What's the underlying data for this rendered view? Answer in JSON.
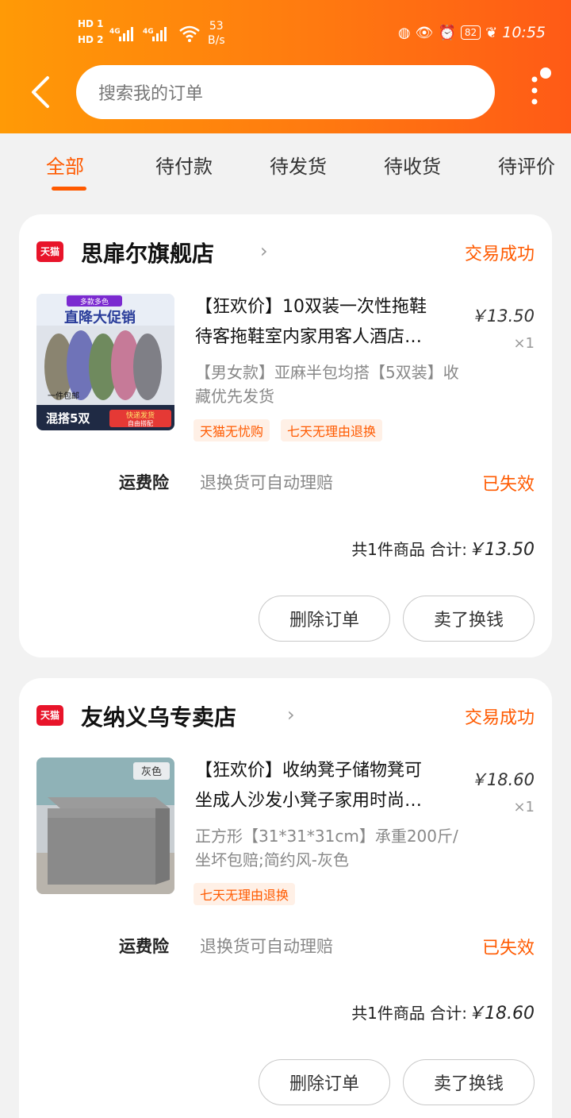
{
  "status_bar": {
    "hd1": "HD 1",
    "hd2": "HD 2",
    "speed_value": "53",
    "speed_unit": "B/s",
    "battery": "82",
    "time": "10:55"
  },
  "header": {
    "search_placeholder": "搜索我的订单"
  },
  "tabs": [
    {
      "label": "全部",
      "active": true
    },
    {
      "label": "待付款",
      "active": false
    },
    {
      "label": "待发货",
      "active": false
    },
    {
      "label": "待收货",
      "active": false
    },
    {
      "label": "待评价",
      "active": false
    }
  ],
  "orders": [
    {
      "platform_badge": "天猫",
      "shop_name": "思扉尔旗舰店",
      "status": "交易成功",
      "product_title_line1": "【狂欢价】10双装一次性拖鞋",
      "product_title_line2": "待客拖鞋室内家用客人酒店…",
      "product_spec": "【男女款】亚麻半包均搭【5双装】收藏优先发货",
      "price": "￥13.50",
      "quantity": "×1",
      "tags": [
        "天猫无忧购",
        "七天无理由退换"
      ],
      "insurance_label": "运费险",
      "insurance_desc": "退换货可自动理赔",
      "insurance_status": "已失效",
      "summary_prefix": "共1件商品 合计:",
      "summary_total": "￥13.50",
      "btn_delete": "删除订单",
      "btn_sell": "卖了换钱",
      "thumb_texts": [
        "多款多色",
        "直降大促销",
        "一件包邮",
        "混搭5双",
        "快递发货",
        "自由搭配"
      ]
    },
    {
      "platform_badge": "天猫",
      "shop_name": "友纳义乌专卖店",
      "status": "交易成功",
      "product_title_line1": "【狂欢价】收纳凳子储物凳可",
      "product_title_line2": "坐成人沙发小凳子家用时尚…",
      "product_spec": "正方形【31*31*31cm】承重200斤/坐坏包赔;简约风-灰色",
      "price": "￥18.60",
      "quantity": "×1",
      "tags": [
        "七天无理由退换"
      ],
      "insurance_label": "运费险",
      "insurance_desc": "退换货可自动理赔",
      "insurance_status": "已失效",
      "summary_prefix": "共1件商品 合计:",
      "summary_total": "￥18.60",
      "btn_delete": "删除订单",
      "btn_sell": "卖了换钱",
      "thumb_texts": [
        "灰色"
      ]
    }
  ],
  "colors": {
    "accent": "#ff5a00",
    "header_start": "#ff9a06",
    "header_end": "#ff5a16",
    "tmall_red": "#e8142a"
  }
}
